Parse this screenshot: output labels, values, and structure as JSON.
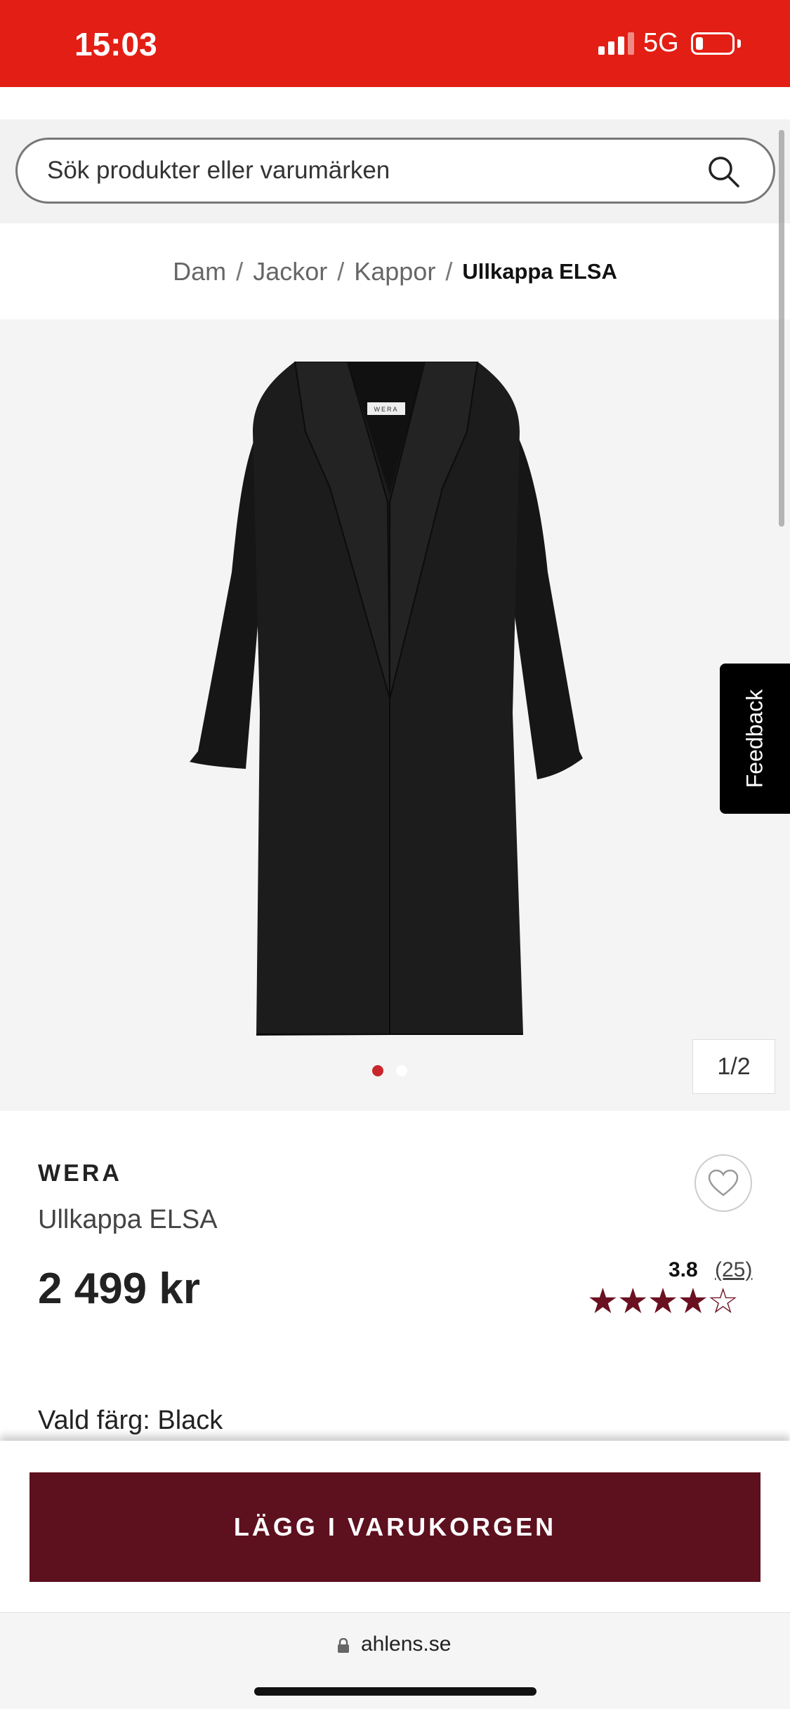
{
  "status_bar": {
    "time": "15:03",
    "network": "5G"
  },
  "search": {
    "placeholder": "Sök produkter eller varumärken"
  },
  "breadcrumb": [
    {
      "label": "Dam"
    },
    {
      "label": "Jackor"
    },
    {
      "label": "Kappor"
    },
    {
      "label": "Ullkappa ELSA"
    }
  ],
  "gallery": {
    "counter": "1/2",
    "coat_tag": "WERA"
  },
  "feedback": {
    "label": "Feedback"
  },
  "product": {
    "brand": "WERA",
    "name": "Ullkappa ELSA",
    "price": "2 499 kr",
    "rating": "3.8",
    "rating_value": 3.8,
    "review_count": "(25)",
    "stars": "★★★★☆",
    "selected_color": "Vald färg: Black"
  },
  "cart": {
    "button_label": "LÄGG I VARUKORGEN"
  },
  "browser": {
    "url": "ahlens.se"
  },
  "colors": {
    "status_bar": "#e31e14",
    "cart_button": "#5d101e",
    "star": "#6a1020",
    "active_dot": "#c8262c"
  }
}
